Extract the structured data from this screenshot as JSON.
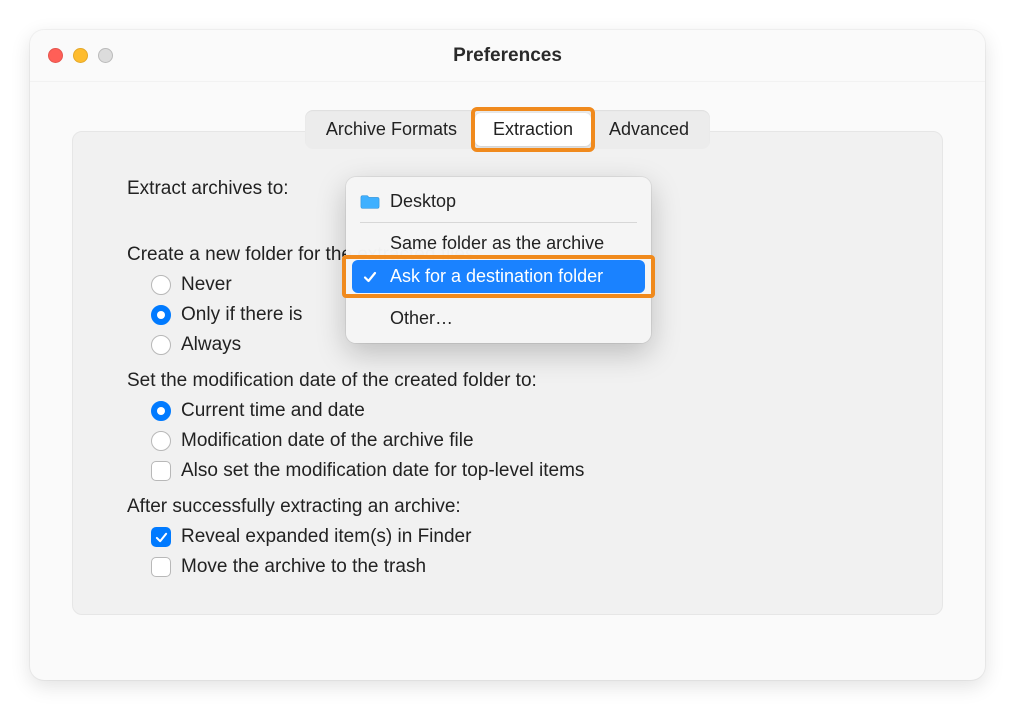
{
  "window": {
    "title": "Preferences"
  },
  "tabs": {
    "archive": "Archive Formats",
    "extraction": "Extraction",
    "advanced": "Advanced"
  },
  "extract_to": {
    "label": "Extract archives to:",
    "options": {
      "desktop": "Desktop",
      "same_folder": "Same folder as the archive",
      "ask": "Ask for a destination folder",
      "other": "Other…"
    }
  },
  "create_folder": {
    "label": "Create a new folder for the extracted files:",
    "never": "Never",
    "only_if_label_partial": "Only if there is",
    "always": "Always"
  },
  "mod_date": {
    "label": "Set the modification date of the created folder to:",
    "current": "Current time and date",
    "archive": "Modification date of the archive file",
    "also": "Also set the modification date for top-level items"
  },
  "after": {
    "label": "After successfully extracting an archive:",
    "reveal": "Reveal expanded item(s) in Finder",
    "trash": "Move the archive to the trash"
  }
}
